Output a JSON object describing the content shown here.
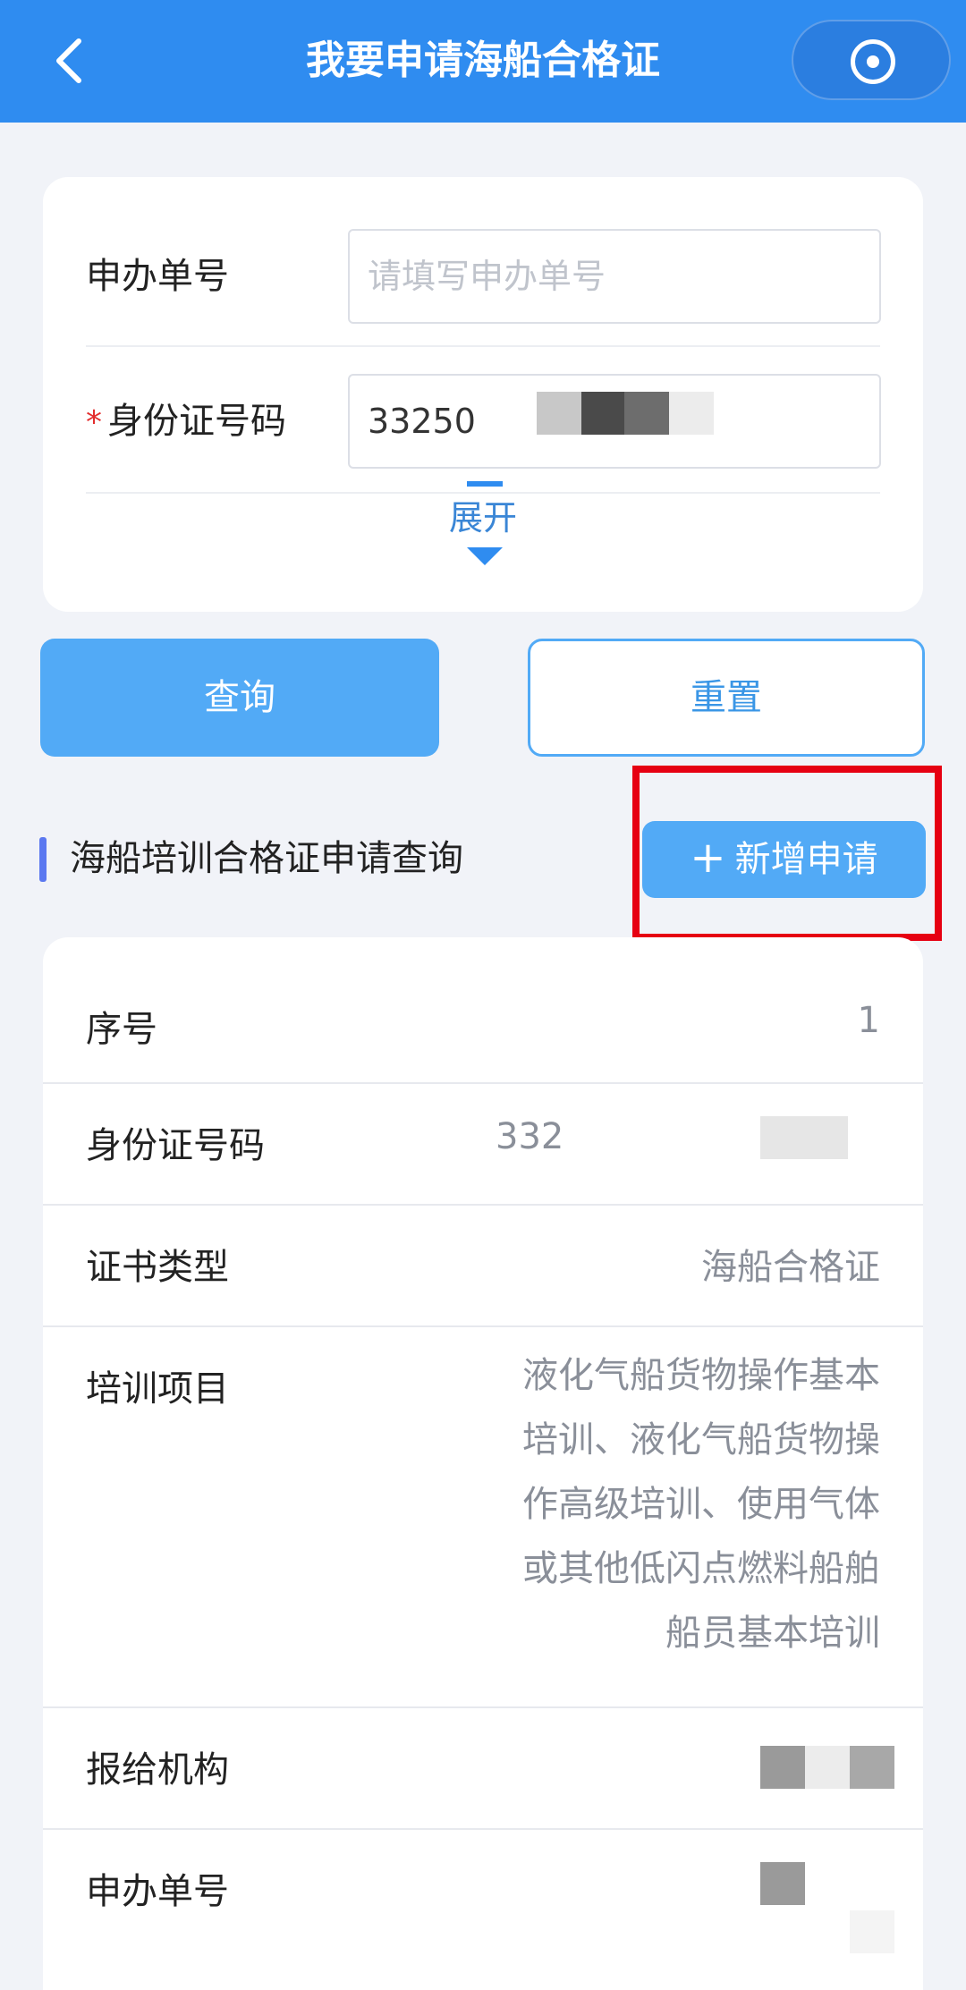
{
  "nav": {
    "title": "我要申请海船合格证"
  },
  "form": {
    "order_no": {
      "label": "申办单号",
      "placeholder": "请填写申办单号"
    },
    "id_no": {
      "required_mark": "*",
      "label": "身份证号码",
      "value": "33250"
    },
    "expand_label": "展开"
  },
  "buttons": {
    "query": "查询",
    "reset": "重置",
    "add": "新增申请",
    "add_icon": "+"
  },
  "section": {
    "title": "海船培训合格证申请查询"
  },
  "record": {
    "rows": [
      {
        "label": "序号",
        "value": "1"
      },
      {
        "label": "身份证号码",
        "value": "332"
      },
      {
        "label": "证书类型",
        "value": "海船合格证"
      },
      {
        "label": "培训项目",
        "value": "液化气船货物操作基本培训、液化气船货物操作高级培训、使用气体或其他低闪点燃料船舶船员基本培训"
      },
      {
        "label": "报给机构",
        "value": ""
      },
      {
        "label": "申办单号",
        "value": ""
      }
    ]
  },
  "colors": {
    "nav": "#2f8cf0",
    "button": "#52aaf6",
    "highlight": "#e60012"
  }
}
